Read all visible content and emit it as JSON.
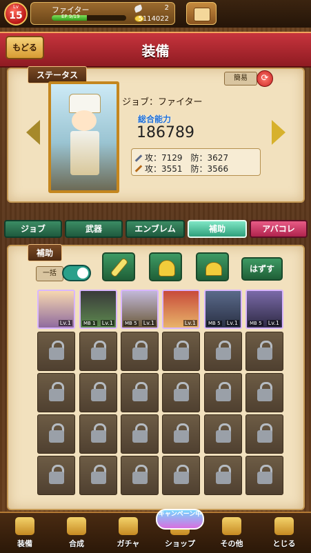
{
  "player": {
    "lv_prefix": "Lv",
    "level": "15",
    "name": "ファイター",
    "ep_label": "EP 9/19",
    "ep_fraction": 0.47,
    "stones": "2",
    "gold": "5114022"
  },
  "header": {
    "back_label": "もどる",
    "title": "装備"
  },
  "status": {
    "section_label": "ステータス",
    "simple_label": "簡易",
    "job_line": "ジョブ：ファイター",
    "power_label": "総合能力",
    "power_value": "186789",
    "stats": {
      "line1": "攻：7129　防：3627",
      "line2": "攻：3551　防：3566"
    }
  },
  "tabs": [
    {
      "label": "ジョブ",
      "active": false
    },
    {
      "label": "武器",
      "active": false
    },
    {
      "label": "エンブレム",
      "active": false
    },
    {
      "label": "補助",
      "active": true
    },
    {
      "label": "アバコレ",
      "active": false
    }
  ],
  "support": {
    "section_label": "補助",
    "bulk_label": "一括",
    "remove_label": "はずす",
    "items": [
      {
        "lv": "Lv.1",
        "mb": ""
      },
      {
        "lv": "Lv.1",
        "mb": "MB 1"
      },
      {
        "lv": "Lv.1",
        "mb": "MB 5"
      },
      {
        "lv": "Lv.1",
        "mb": ""
      },
      {
        "lv": "Lv.1",
        "mb": "MB 5"
      },
      {
        "lv": "Lv.1",
        "mb": "MB 5"
      }
    ]
  },
  "nav": {
    "campaign": "キャンペーン中",
    "items": [
      {
        "label": "装備"
      },
      {
        "label": "合成"
      },
      {
        "label": "ガチャ"
      },
      {
        "label": "ショップ"
      },
      {
        "label": "その他"
      },
      {
        "label": "とじる"
      }
    ]
  }
}
